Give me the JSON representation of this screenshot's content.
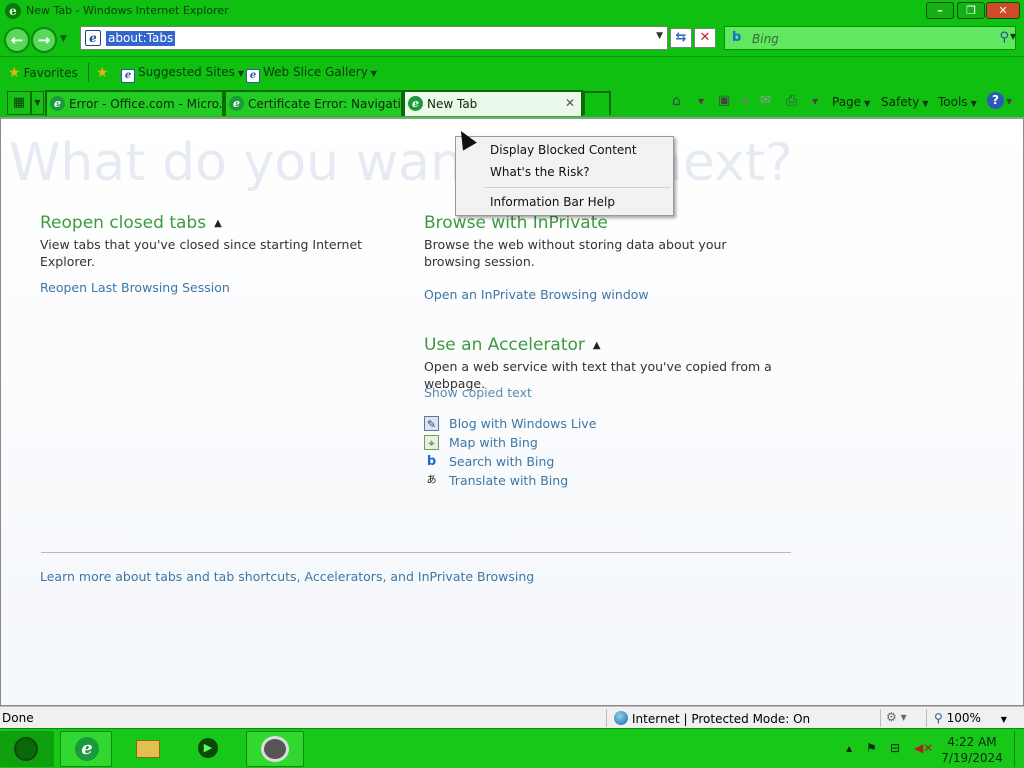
{
  "window": {
    "title": "New Tab - Windows Internet Explorer",
    "minimize": "–",
    "restore": "❐",
    "close": "✕"
  },
  "nav": {
    "address": "about:Tabs",
    "search_placeholder": "Bing",
    "search_logo": "b"
  },
  "favorites": {
    "favorites_label": "Favorites",
    "suggested_sites": "Suggested Sites",
    "web_slice_gallery": "Web Slice Gallery"
  },
  "tabs": [
    {
      "label": "Error - Office.com - Micro..."
    },
    {
      "label": "Certificate Error: Navigatio..."
    },
    {
      "label": "New Tab"
    }
  ],
  "command_bar": {
    "page": "Page",
    "safety": "Safety",
    "tools": "Tools"
  },
  "content": {
    "big_question": "What do you want to do next?",
    "reopen_heading": "Reopen closed tabs",
    "reopen_desc": "View tabs that you've closed since starting Internet Explorer.",
    "reopen_last_session": "Reopen Last Browsing Session",
    "inprivate_heading": "Browse with InPrivate",
    "inprivate_desc": "Browse the web without storing data about your browsing session.",
    "inprivate_link": "Open an InPrivate Browsing window",
    "accelerator_heading": "Use an Accelerator",
    "accelerator_desc": "Open a web service with text that you've copied from a webpage.",
    "show_copied_text": "Show copied text",
    "accelerators": [
      {
        "label": "Blog with Windows Live",
        "icon": "blog-icon"
      },
      {
        "label": "Map with Bing",
        "icon": "map-icon"
      },
      {
        "label": "Search with Bing",
        "icon": "bing-icon"
      },
      {
        "label": "Translate with Bing",
        "icon": "translate-icon"
      }
    ],
    "learn_more": "Learn more about tabs and tab shortcuts, Accelerators, and InPrivate Browsing"
  },
  "context_menu": {
    "items": [
      "Display Blocked Content",
      "What's the Risk?",
      "Information Bar Help"
    ]
  },
  "status": {
    "done": "Done",
    "zone": "Internet | Protected Mode: On",
    "zoom": "100%"
  },
  "taskbar": {
    "time": "4:22 AM",
    "date": "7/19/2024"
  },
  "colors": {
    "chrome_green": "#10c010",
    "heading_green": "#3e9a3e",
    "link_blue": "#3d77a6"
  }
}
